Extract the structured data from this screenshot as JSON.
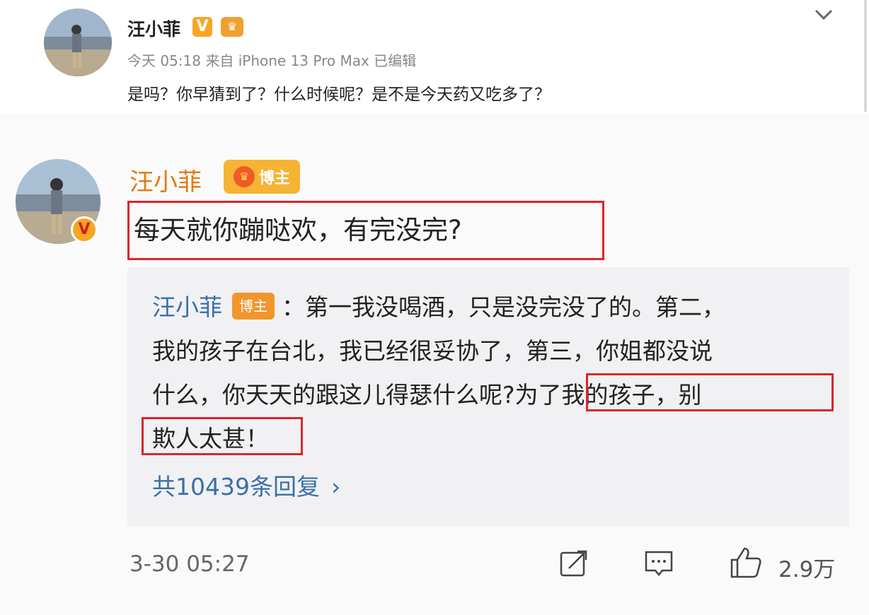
{
  "post1": {
    "author": "汪小菲",
    "verified_badge": "V",
    "meta": "今天 05:18 来自 iPhone 13 Pro Max   已编辑",
    "text": "是吗？你早猜到了？什么时候呢？是不是今天药又吃多了？"
  },
  "comment": {
    "author": "汪小菲",
    "author_badge": "博主",
    "verified_badge": "V",
    "text": "每天就你蹦哒欢，有完没完?",
    "reply": {
      "author": "汪小菲",
      "author_badge": "博主",
      "line1_rest": "：第一我没喝酒，只是没完没了的。第二，",
      "line2": "我的孩子在台北，我已经很妥协了，第三，你姐都没说",
      "line3": "什么，你天天的跟这儿得瑟什么呢?为了我的孩子，别",
      "line4": "欺人太甚！"
    },
    "reply_count": "共10439条回复",
    "timestamp": "3-30 05:27",
    "likes": "2.9万"
  },
  "colors": {
    "accent_name": "#e07b12",
    "link_blue": "#3a6fa8",
    "highlight_red": "#d9262c",
    "badge_orange": "#f7b334"
  },
  "icons": [
    "chevron-down-icon",
    "share-icon",
    "comment-icon",
    "like-icon"
  ]
}
